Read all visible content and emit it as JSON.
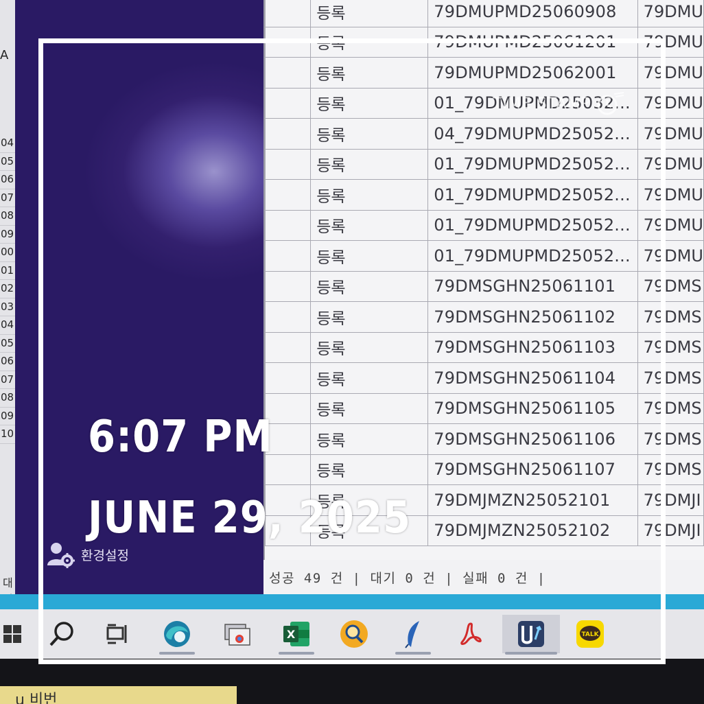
{
  "spreadsheet_edge": {
    "fragment_top": "A",
    "row_numbers": [
      "04",
      "05",
      "06",
      "07",
      "08",
      "09",
      "00",
      "01",
      "02",
      "03",
      "04",
      "05",
      "06",
      "07",
      "08",
      "09",
      "10"
    ],
    "fragment_bottom": "대성"
  },
  "sidebar": {
    "settings_label": "환경설정",
    "accent_color": "#2a1a64"
  },
  "table": {
    "rows": [
      {
        "status": "등록",
        "id": "79DMUPMD25060908",
        "next": "79DMU"
      },
      {
        "status": "등록",
        "id": "79DMUPMD25061201",
        "next": "79DMU"
      },
      {
        "status": "등록",
        "id": "79DMUPMD25062001",
        "next": "79DMU"
      },
      {
        "status": "등록",
        "id": "01_79DMUPMD25032...",
        "next": "79DMU"
      },
      {
        "status": "등록",
        "id": "04_79DMUPMD25052...",
        "next": "79DMU"
      },
      {
        "status": "등록",
        "id": "01_79DMUPMD25052...",
        "next": "79DMU"
      },
      {
        "status": "등록",
        "id": "01_79DMUPMD25052...",
        "next": "79DMU"
      },
      {
        "status": "등록",
        "id": "01_79DMUPMD25052...",
        "next": "79DMU"
      },
      {
        "status": "등록",
        "id": "01_79DMUPMD25052...",
        "next": "79DMU"
      },
      {
        "status": "등록",
        "id": "79DMSGHN25061101",
        "next": "79DMS"
      },
      {
        "status": "등록",
        "id": "79DMSGHN25061102",
        "next": "79DMS"
      },
      {
        "status": "등록",
        "id": "79DMSGHN25061103",
        "next": "79DMS"
      },
      {
        "status": "등록",
        "id": "79DMSGHN25061104",
        "next": "79DMS"
      },
      {
        "status": "등록",
        "id": "79DMSGHN25061105",
        "next": "79DMS"
      },
      {
        "status": "등록",
        "id": "79DMSGHN25061106",
        "next": "79DMS"
      },
      {
        "status": "등록",
        "id": "79DMSGHN25061107",
        "next": "79DMS"
      },
      {
        "status": "등록",
        "id": "79DMJMZN25052101",
        "next": "79DMJI"
      },
      {
        "status": "등록",
        "id": "79DMJMZN25052102",
        "next": "79DMJI"
      }
    ]
  },
  "status_bar": {
    "text": "성공 49 건 | 대기 0 건 | 실패 0 건 |"
  },
  "taskbar": {
    "icons": [
      "windows-start",
      "search",
      "task-view",
      "browser-edge",
      "chrome-window",
      "excel",
      "magnifier-app",
      "feather-pen",
      "acrobat",
      "server-app",
      "kakaotalk"
    ],
    "kakao_label": "TALK",
    "excel_label": "X"
  },
  "overlay": {
    "time": "6:07 PM",
    "date": "JUNE 29, 2025",
    "watermark": "TIME STAMP"
  },
  "sticky_note": {
    "text": "u  비번"
  }
}
